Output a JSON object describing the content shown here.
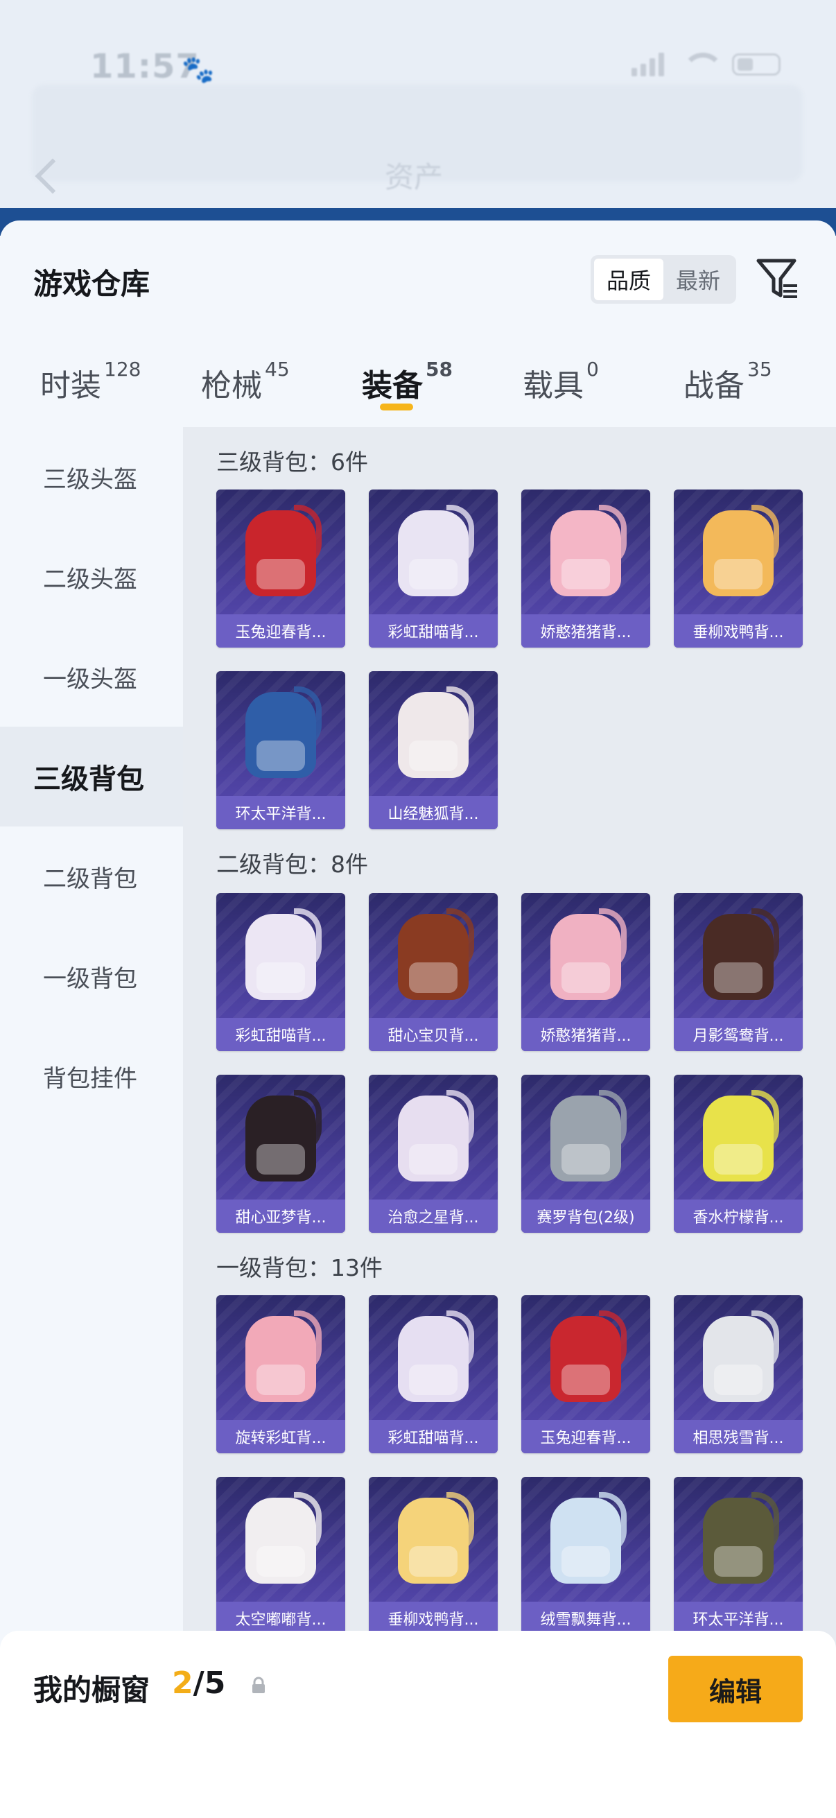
{
  "status_bar": {
    "time": "11:57"
  },
  "background_header": {
    "title": "资产"
  },
  "sheet": {
    "title": "游戏仓库"
  },
  "sort": {
    "options": [
      "品质",
      "最新"
    ],
    "selected": "品质"
  },
  "tabs": [
    {
      "label": "时装",
      "count": "128"
    },
    {
      "label": "枪械",
      "count": "45"
    },
    {
      "label": "装备",
      "count": "58",
      "active": true
    },
    {
      "label": "载具",
      "count": "0"
    },
    {
      "label": "战备",
      "count": "35"
    }
  ],
  "sidebar": {
    "items": [
      "三级头盔",
      "二级头盔",
      "一级头盔",
      "三级背包",
      "二级背包",
      "一级背包",
      "背包挂件"
    ],
    "active": "三级背包"
  },
  "sections": [
    {
      "title": "三级背包：6件",
      "items": [
        {
          "name": "玉兔迎春背...",
          "color": "#c9252c"
        },
        {
          "name": "彩虹甜喵背...",
          "color": "#e9e4f3"
        },
        {
          "name": "娇憨猪猪背...",
          "color": "#f4b6c6"
        },
        {
          "name": "垂柳戏鸭背...",
          "color": "#f3b95a"
        },
        {
          "name": "环太平洋背...",
          "color": "#2f5ea8"
        },
        {
          "name": "山经魅狐背...",
          "color": "#efe8ea"
        }
      ]
    },
    {
      "title": "二级背包：8件",
      "items": [
        {
          "name": "彩虹甜喵背...",
          "color": "#ece6f4"
        },
        {
          "name": "甜心宝贝背...",
          "color": "#8a3b22"
        },
        {
          "name": "娇憨猪猪背...",
          "color": "#f0b1c2"
        },
        {
          "name": "月影鸳鸯背...",
          "color": "#4a2b25"
        },
        {
          "name": "甜心亚梦背...",
          "color": "#2a2025"
        },
        {
          "name": "治愈之星背...",
          "color": "#e7def0"
        },
        {
          "name": "赛罗背包(2级)",
          "color": "#9aa3ad"
        },
        {
          "name": "香水柠檬背...",
          "color": "#e8e24a"
        }
      ]
    },
    {
      "title": "一级背包：13件",
      "items": [
        {
          "name": "旋转彩虹背...",
          "color": "#f2a9b8"
        },
        {
          "name": "彩虹甜喵背...",
          "color": "#e6dff2"
        },
        {
          "name": "玉兔迎春背...",
          "color": "#c9272f"
        },
        {
          "name": "相思残雪背...",
          "color": "#e3e5ea"
        },
        {
          "name": "太空嘟嘟背...",
          "color": "#f1eef0"
        },
        {
          "name": "垂柳戏鸭背...",
          "color": "#f5d37a"
        },
        {
          "name": "绒雪飘舞背...",
          "color": "#cfe1f2"
        },
        {
          "name": "环太平洋背...",
          "color": "#5b5a3a"
        }
      ]
    }
  ],
  "bottom_bar": {
    "label": "我的橱窗",
    "current": "2",
    "separator": "/",
    "total": "5",
    "edit_label": "编辑"
  },
  "icons": {
    "filter": "filter-icon",
    "share": "share-icon",
    "lock": "lock-icon",
    "back": "back-icon"
  },
  "colors": {
    "accent": "#f6aa19",
    "card": "#4a3f9c"
  }
}
